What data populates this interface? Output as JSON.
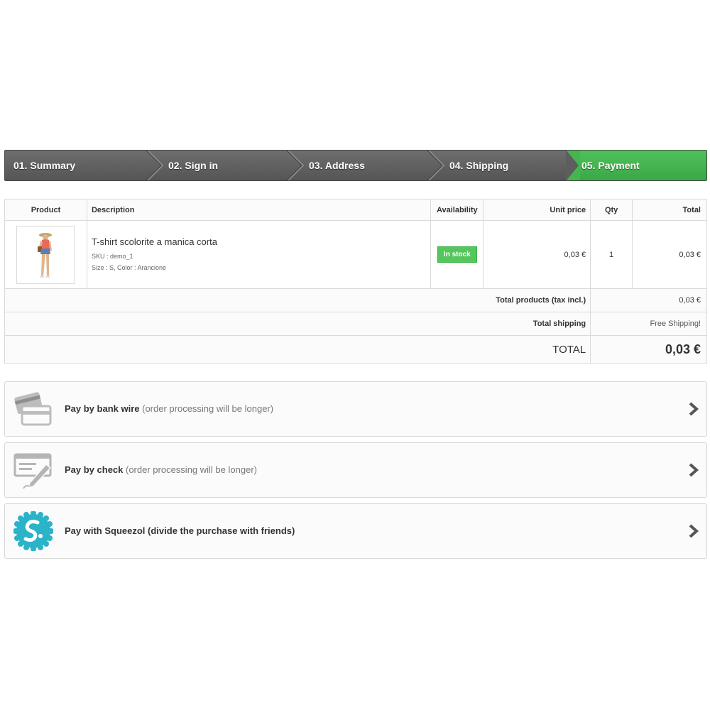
{
  "steps": [
    {
      "label": "01. Summary",
      "active": false
    },
    {
      "label": "02. Sign in",
      "active": false
    },
    {
      "label": "03. Address",
      "active": false
    },
    {
      "label": "04. Shipping",
      "active": false
    },
    {
      "label": "05. Payment",
      "active": true
    }
  ],
  "table": {
    "headers": {
      "product": "Product",
      "description": "Description",
      "availability": "Availability",
      "unit_price": "Unit price",
      "qty": "Qty",
      "total": "Total"
    },
    "item": {
      "name": "T-shirt scolorite a manica corta",
      "sku": "SKU : demo_1",
      "attributes": "Size : S, Color : Arancione",
      "availability": "In stock",
      "unit_price": "0,03 €",
      "qty": "1",
      "total": "0,03 €"
    },
    "summary": {
      "total_products_label": "Total products (tax incl.)",
      "total_products_value": "0,03 €",
      "total_shipping_label": "Total shipping",
      "total_shipping_value": "Free Shipping!",
      "total_label": "TOTAL",
      "total_value": "0,03 €"
    }
  },
  "payments": [
    {
      "main": "Pay by bank wire",
      "extra": " (order processing will be longer)",
      "icon": "bank-card-icon"
    },
    {
      "main": "Pay by check",
      "extra": " (order processing will be longer)",
      "icon": "check-pen-icon"
    },
    {
      "main": "Pay with Squeezol (divide the purchase with friends)",
      "extra": "",
      "icon": "squeezol-logo-icon"
    }
  ],
  "colors": {
    "active_step": "#45b550",
    "in_stock": "#55c65e",
    "squeezol": "#2bb3c8"
  }
}
